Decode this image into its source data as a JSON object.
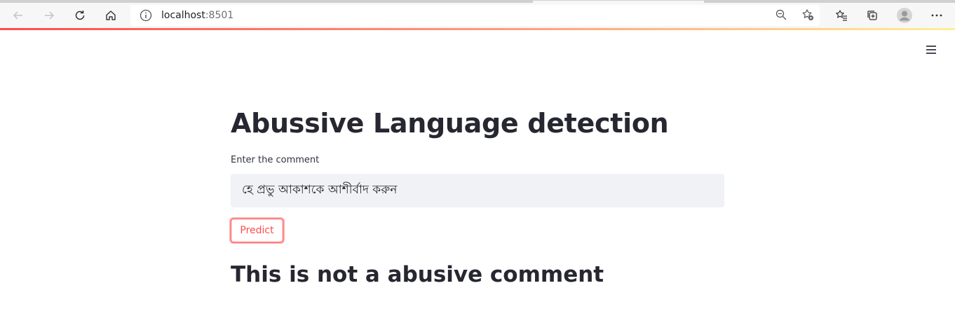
{
  "browser": {
    "url_host": "localhost",
    "url_port": ":8501"
  },
  "page": {
    "title": "Abussive Language detection",
    "input_label": "Enter the comment",
    "input_value": "হে প্রভু আকাশকে আশীর্বাদ করুন",
    "predict_label": "Predict",
    "result_text": "This is not a abusive comment"
  },
  "colors": {
    "accent": "#ff4b4b",
    "text": "#262730",
    "input_bg": "#f0f2f6"
  }
}
